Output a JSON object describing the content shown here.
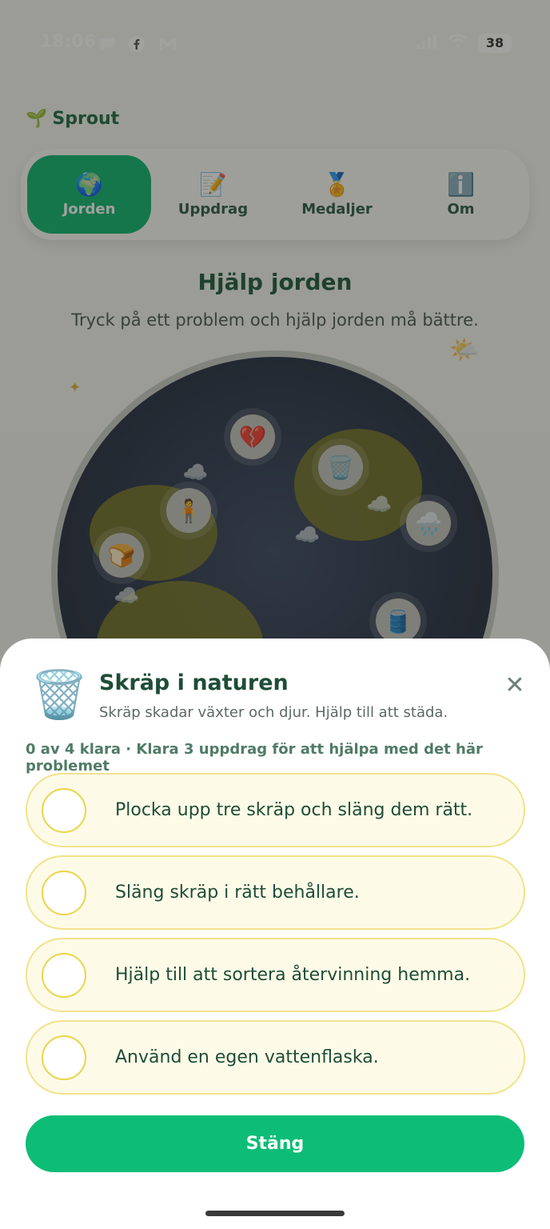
{
  "status_bar": {
    "time": "18:06",
    "battery": "38"
  },
  "app": {
    "brand": "Sprout",
    "tabs": [
      {
        "label": "Jorden",
        "icon": "globe-icon",
        "active": true
      },
      {
        "label": "Uppdrag",
        "icon": "memo-icon",
        "active": false
      },
      {
        "label": "Medaljer",
        "icon": "medal-icon",
        "active": false
      },
      {
        "label": "Om",
        "icon": "info-icon",
        "active": false
      }
    ],
    "heading": "Hjälp jorden",
    "subheading": "Tryck på ett problem och hjälp jorden må bättre."
  },
  "sheet": {
    "icon": "wastebasket-icon",
    "title": "Skräp i naturen",
    "description": "Skräp skadar växter och djur. Hjälp till att städa.",
    "progress": "0 av 4 klara · Klara 3 uppdrag för att hjälpa med det här problemet",
    "tasks": [
      {
        "label": "Plocka upp tre skräp och släng dem rätt.",
        "done": false
      },
      {
        "label": "Släng skräp i rätt behållare.",
        "done": false
      },
      {
        "label": "Hjälp till att sortera återvinning hemma.",
        "done": false
      },
      {
        "label": "Använd en egen vattenflaska.",
        "done": false
      }
    ],
    "close_label": "Stäng"
  },
  "colors": {
    "accent": "#0dbd77",
    "task_bg": "#fdfbe8",
    "task_border": "#f2e28a"
  }
}
